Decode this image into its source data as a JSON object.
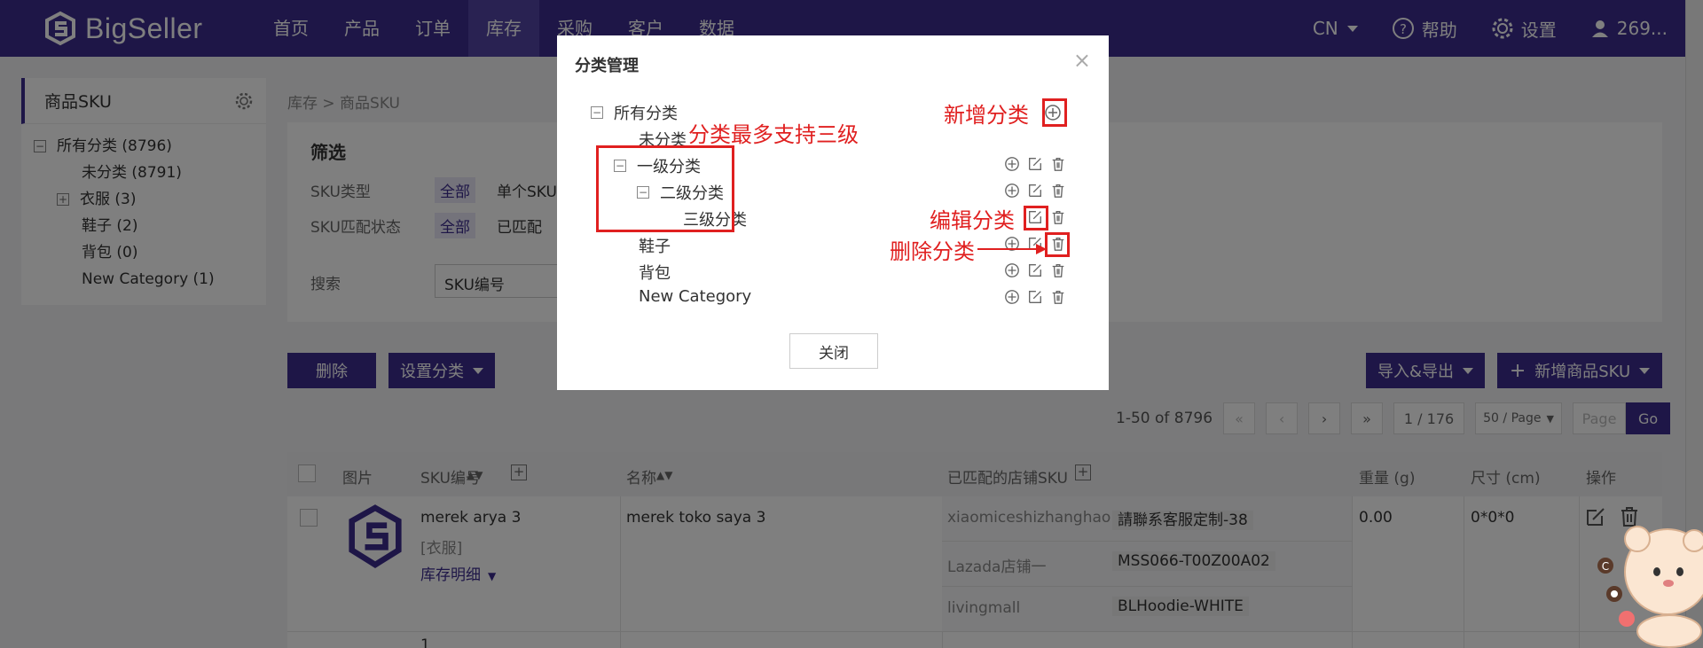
{
  "app": {
    "logo_text": "BigSeller"
  },
  "nav": {
    "items": [
      "首页",
      "产品",
      "订单",
      "库存",
      "采购",
      "客户",
      "数据"
    ],
    "right": {
      "lang": "CN",
      "help": "帮助",
      "settings": "设置",
      "user": "269..."
    }
  },
  "sidebar": {
    "title": "商品SKU",
    "tree": [
      {
        "label": "所有分类 (8796)",
        "toggle": "−"
      },
      {
        "label": "未分类 (8791)"
      },
      {
        "label": "衣服 (3)",
        "toggle": "+"
      },
      {
        "label": "鞋子 (2)"
      },
      {
        "label": "背包 (0)"
      },
      {
        "label": "New Category (1)"
      }
    ]
  },
  "breadcrumb": "库存 > 商品SKU",
  "filter": {
    "title": "筛选",
    "sku_type_label": "SKU类型",
    "sku_type_all": "全部",
    "sku_type_single": "单个SKU",
    "match_label": "SKU匹配状态",
    "match_all": "全部",
    "match_matched": "已匹配",
    "search_label": "搜索",
    "search_field": "SKU编号"
  },
  "toolbar": {
    "delete": "删除",
    "set_category": "设置分类",
    "import_export": "导入&导出",
    "add_sku": "新增商品SKU"
  },
  "pagination": {
    "range": "1-50 of 8796",
    "first": "«",
    "prev": "‹",
    "next": "›",
    "last": "»",
    "page": "1 / 176",
    "per_page": "50 / Page",
    "page_placeholder": "Page",
    "go": "Go"
  },
  "table": {
    "headers": [
      "图片",
      "SKU编号",
      "名称",
      "已匹配的店铺SKU",
      "重量 (g)",
      "尺寸 (cm)",
      "操作"
    ],
    "rows": [
      {
        "sku": "merek arya 3",
        "category": "[衣服]",
        "stock_link": "库存明细",
        "name": "merek toko saya 3",
        "shops": [
          {
            "store": "xiaomiceshizhanghao",
            "sku": "請聯系客服定制-38"
          },
          {
            "store": "Lazada店铺一",
            "sku": "MSS066-T00Z00A02"
          },
          {
            "store": "livingmall",
            "sku": "BLHoodie-WHITE"
          }
        ],
        "weight": "0.00",
        "size": "0*0*0"
      }
    ],
    "next_row_partial": "1"
  },
  "modal": {
    "title": "分类管理",
    "close_x": "×",
    "tree": [
      {
        "label": "所有分类",
        "toggle": "−"
      },
      {
        "label": "未分类"
      },
      {
        "label": "一级分类",
        "toggle": "−"
      },
      {
        "label": "二级分类",
        "toggle": "−"
      },
      {
        "label": "三级分类"
      },
      {
        "label": "鞋子"
      },
      {
        "label": "背包"
      },
      {
        "label": "New Category"
      }
    ],
    "close_button": "关闭",
    "annotations": {
      "add_category": "新增分类",
      "max_levels": "分类最多支持三级",
      "edit_category": "编辑分类",
      "delete_category": "删除分类"
    }
  },
  "colors": {
    "brand": "#3c2c8f",
    "annotation": "#e02020"
  }
}
